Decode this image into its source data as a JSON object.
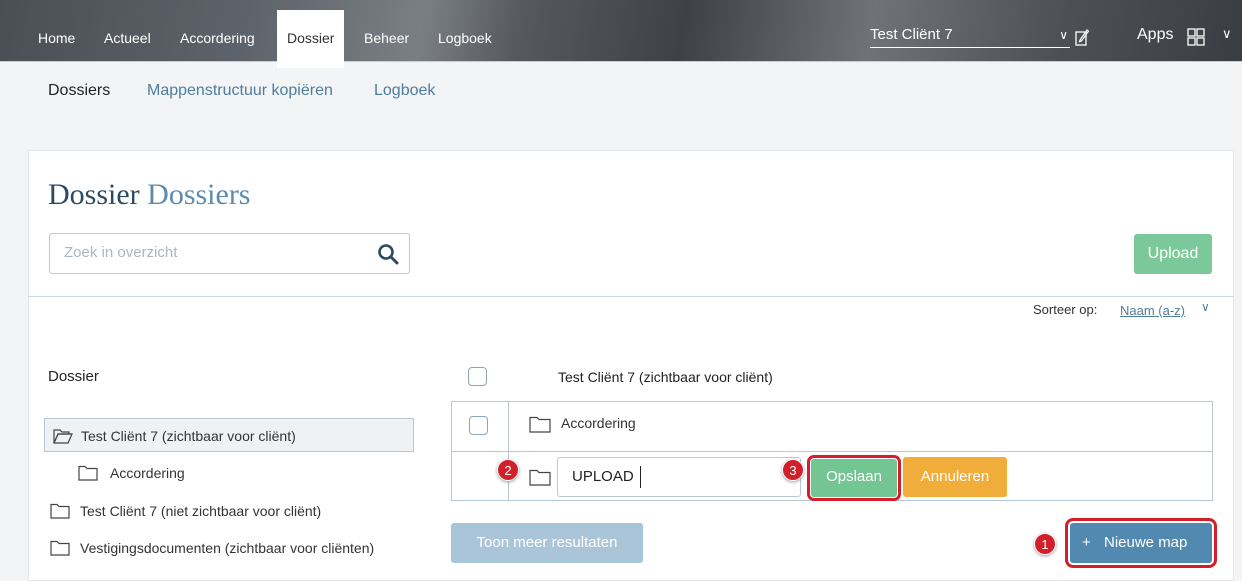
{
  "topbar": {
    "nav": [
      "Home",
      "Actueel",
      "Accordering",
      "Dossier",
      "Beheer",
      "Logboek"
    ],
    "active": "Dossier",
    "client_select": "Test Cliënt 7",
    "apps_label": "Apps",
    "icons": [
      "chevron-down-icon",
      "edit-icon",
      "apps-grid-icon"
    ]
  },
  "subnav": {
    "items": [
      "Dossiers",
      "Mappenstructuur kopiëren",
      "Logboek"
    ]
  },
  "page": {
    "title_part1": "Dossier",
    "title_part2": "Dossiers"
  },
  "search": {
    "placeholder": "Zoek in overzicht",
    "value": ""
  },
  "toolbar": {
    "upload_label": "Upload",
    "sort_label": "Sorteer op:",
    "sort_value": "Naam (a-z)"
  },
  "tree": {
    "title": "Dossier",
    "items": [
      {
        "label": "Test Cliënt 7 (zichtbaar voor cliënt)",
        "selected": true,
        "open": true
      },
      {
        "label": "Accordering",
        "selected": false,
        "open": false
      },
      {
        "label": "Test Cliënt 7 (niet zichtbaar voor cliënt)",
        "selected": false,
        "open": false
      },
      {
        "label": "Vestigingsdocumenten (zichtbaar voor cliënten)",
        "selected": false,
        "open": false
      }
    ]
  },
  "table": {
    "header_title": "Test Cliënt 7 (zichtbaar voor cliënt)",
    "rows": [
      {
        "label": "Accordering"
      }
    ],
    "new_folder": {
      "value": "UPLOAD",
      "save_label": "Opslaan",
      "cancel_label": "Annuleren"
    }
  },
  "footer": {
    "more_label": "Toon meer resultaten",
    "new_map_plus": "+",
    "new_map_label": "Nieuwe map"
  },
  "annotations": {
    "badge1": "1",
    "badge2": "2",
    "badge3": "3"
  },
  "colors": {
    "accent_blue": "#5189b0",
    "save_green": "#73c592",
    "cancel_orange": "#f0ad3a",
    "annotation_red": "#d1202c"
  }
}
